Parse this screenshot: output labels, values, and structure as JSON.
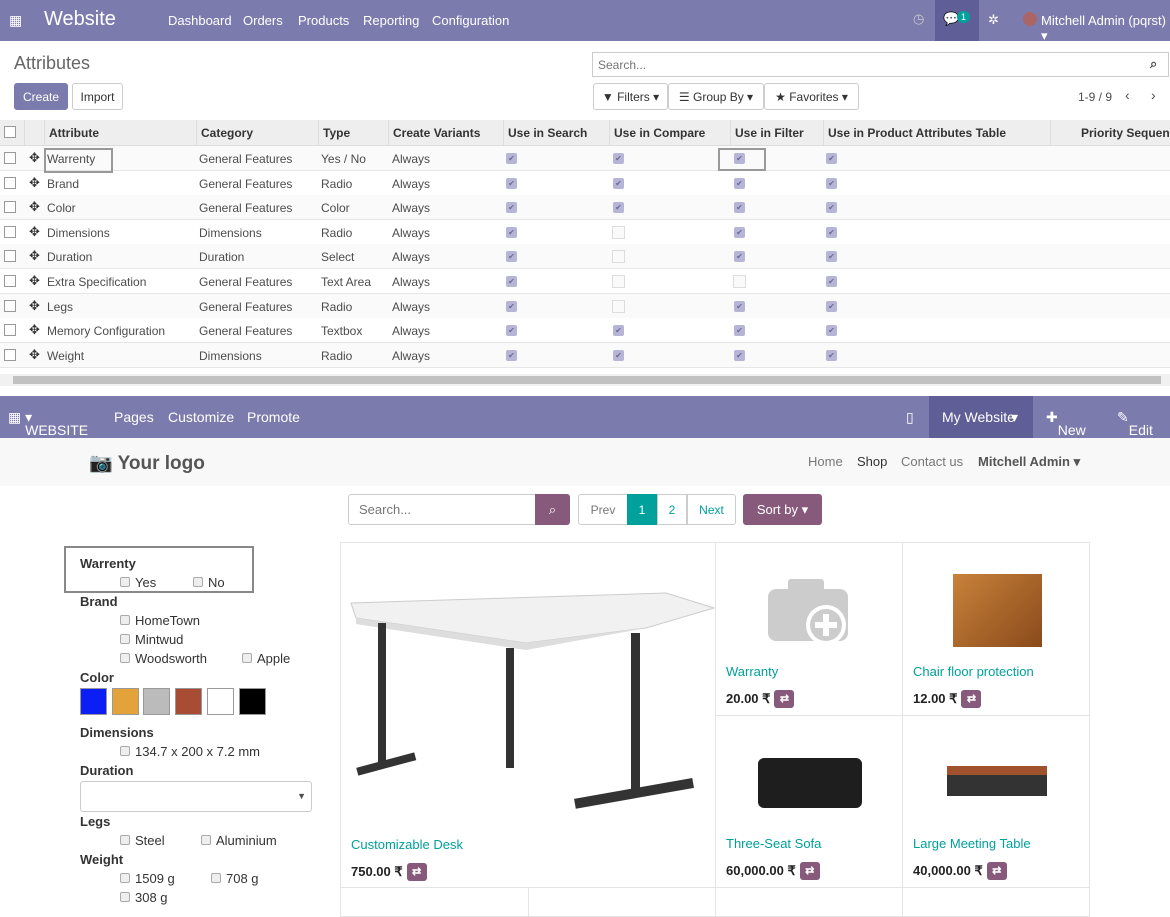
{
  "topbar": {
    "app": "Website",
    "menu": [
      "Dashboard",
      "Orders",
      "Products",
      "Reporting",
      "Configuration"
    ],
    "chat_count": "1",
    "user": "Mitchell Admin (pqrst)"
  },
  "control": {
    "title": "Attributes",
    "create": "Create",
    "import": "Import",
    "search_placeholder": "Search...",
    "filters": "Filters",
    "group_by": "Group By",
    "favorites": "Favorites",
    "pager": "1-9 / 9"
  },
  "table": {
    "columns": [
      "Attribute",
      "Category",
      "Type",
      "Create Variants",
      "Use in Search",
      "Use in Compare",
      "Use in Filter",
      "Use in Product Attributes Table",
      "Priority Sequence"
    ],
    "rows": [
      {
        "name": "Warrenty",
        "category": "General Features",
        "type": "Yes / No",
        "variants": "Always",
        "search": true,
        "compare": true,
        "filter": true,
        "pat": true
      },
      {
        "name": "Brand",
        "category": "General Features",
        "type": "Radio",
        "variants": "Always",
        "search": true,
        "compare": true,
        "filter": true,
        "pat": true
      },
      {
        "name": "Color",
        "category": "General Features",
        "type": "Color",
        "variants": "Always",
        "search": true,
        "compare": true,
        "filter": true,
        "pat": true
      },
      {
        "name": "Dimensions",
        "category": "Dimensions",
        "type": "Radio",
        "variants": "Always",
        "search": true,
        "compare": false,
        "filter": true,
        "pat": true
      },
      {
        "name": "Duration",
        "category": "Duration",
        "type": "Select",
        "variants": "Always",
        "search": true,
        "compare": false,
        "filter": true,
        "pat": true
      },
      {
        "name": "Extra Specification",
        "category": "General Features",
        "type": "Text Area",
        "variants": "Always",
        "search": true,
        "compare": false,
        "filter": false,
        "pat": true
      },
      {
        "name": "Legs",
        "category": "General Features",
        "type": "Radio",
        "variants": "Always",
        "search": true,
        "compare": false,
        "filter": true,
        "pat": true
      },
      {
        "name": "Memory Configuration",
        "category": "General Features",
        "type": "Textbox",
        "variants": "Always",
        "search": true,
        "compare": true,
        "filter": true,
        "pat": true
      },
      {
        "name": "Weight",
        "category": "Dimensions",
        "type": "Radio",
        "variants": "Always",
        "search": true,
        "compare": true,
        "filter": true,
        "pat": true
      }
    ]
  },
  "webbar": {
    "website": "WEBSITE",
    "pages": "Pages",
    "customize": "Customize",
    "promote": "Promote",
    "my_website": "My Website",
    "new": "New",
    "edit": "Edit"
  },
  "site": {
    "logo": "Your logo",
    "nav": [
      "Home",
      "Shop",
      "Contact us"
    ],
    "user": "Mitchell Admin",
    "search_placeholder": "Search...",
    "prev": "Prev",
    "pages": [
      "1",
      "2"
    ],
    "next": "Next",
    "sort": "Sort by"
  },
  "filters": {
    "warrenty": {
      "label": "Warrenty",
      "options": [
        "Yes",
        "No"
      ]
    },
    "brand": {
      "label": "Brand",
      "options": [
        "HomeTown",
        "Mintwud",
        "Woodsworth",
        "Apple"
      ]
    },
    "color": {
      "label": "Color",
      "swatches": [
        "#0a1ef5",
        "#e3a23a",
        "#bbbbbb",
        "#a84c34",
        "#ffffff",
        "#000000"
      ]
    },
    "dimensions": {
      "label": "Dimensions",
      "options": [
        "134.7 x 200 x 7.2 mm"
      ]
    },
    "duration": {
      "label": "Duration"
    },
    "legs": {
      "label": "Legs",
      "options": [
        "Steel",
        "Aluminium"
      ]
    },
    "weight": {
      "label": "Weight",
      "options": [
        "1509 g",
        "708 g",
        "308 g"
      ]
    }
  },
  "products": [
    {
      "name": "Customizable Desk",
      "price": "750.00 ₹"
    },
    {
      "name": "Warranty",
      "price": "20.00 ₹"
    },
    {
      "name": "Chair floor protection",
      "price": "12.00 ₹"
    },
    {
      "name": "Three-Seat Sofa",
      "price": "60,000.00 ₹"
    },
    {
      "name": "Large Meeting Table",
      "price": "40,000.00 ₹"
    }
  ],
  "colors": {
    "primary": "#7c7bad",
    "accent": "#00a09d",
    "shop_button": "#875a7b"
  }
}
